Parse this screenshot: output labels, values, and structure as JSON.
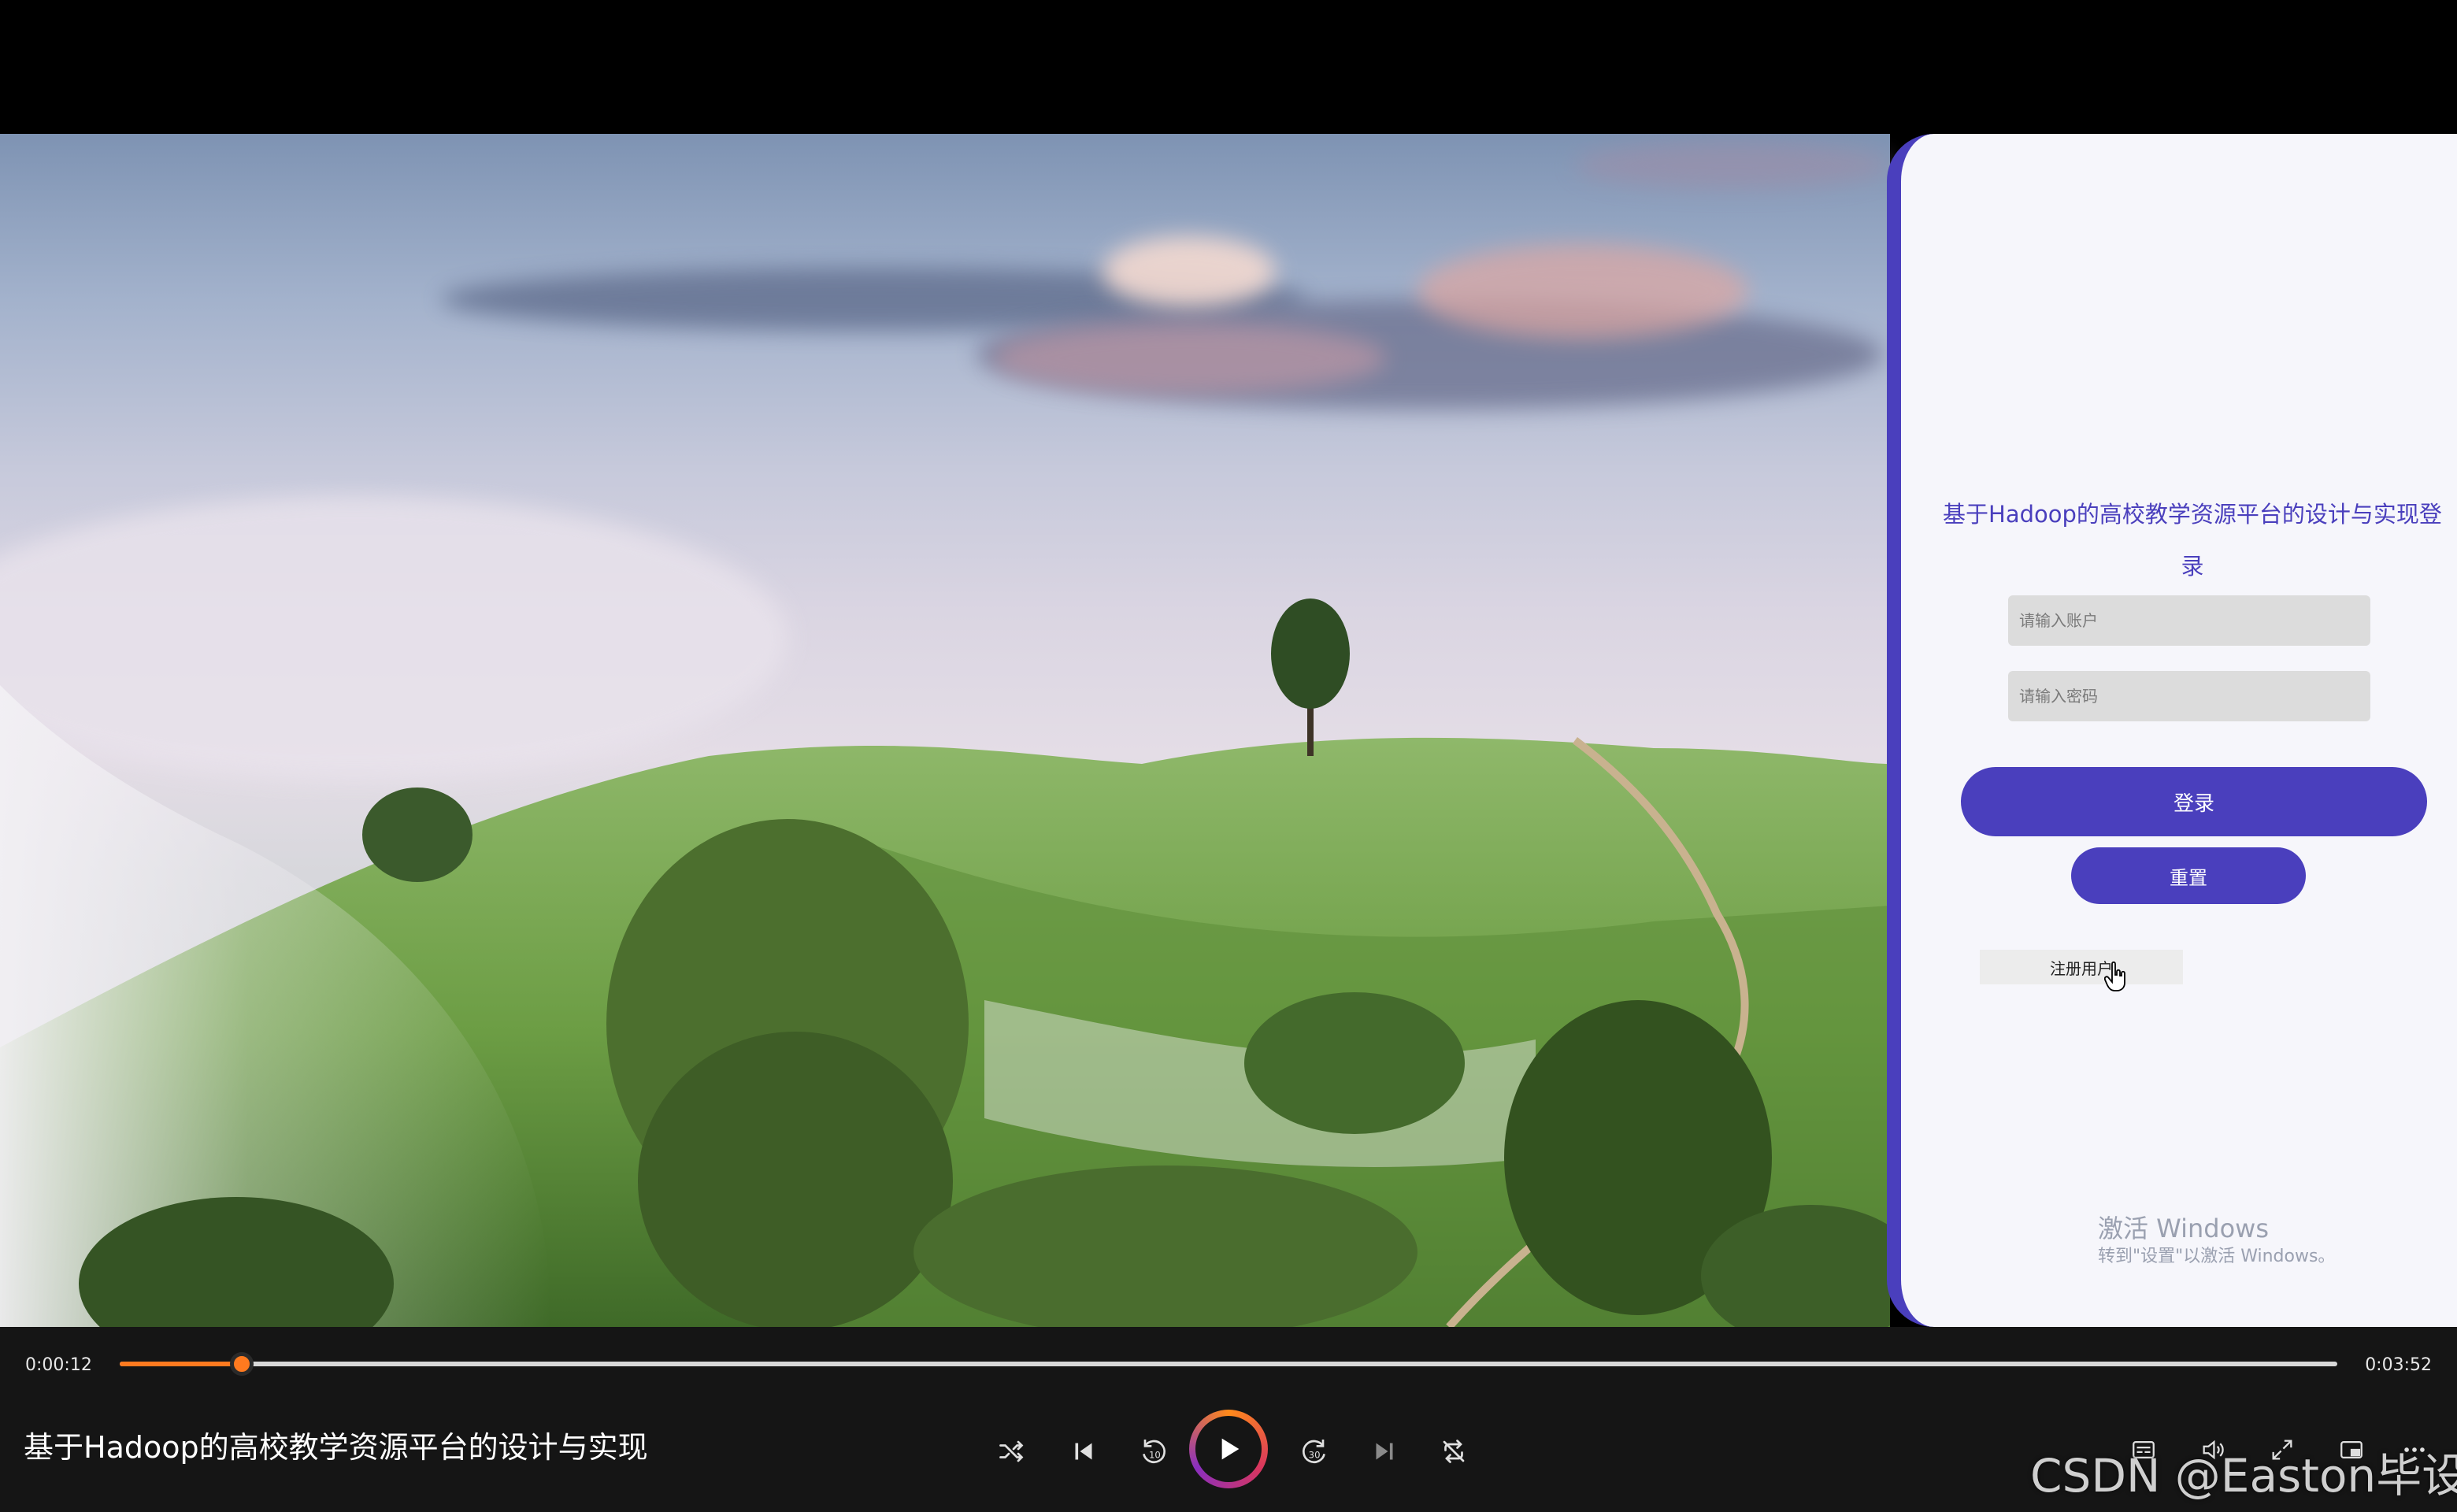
{
  "login": {
    "title": "基于Hadoop的高校教学资源平台的设计与实现登录",
    "account_placeholder": "请输入账户",
    "password_placeholder": "请输入密码",
    "login_label": "登录",
    "reset_label": "重置",
    "register_label": "注册用户",
    "accent_color": "#4a3fbd"
  },
  "windows_activation": {
    "title": "激活 Windows",
    "subtitle": "转到\"设置\"以激活 Windows。"
  },
  "player": {
    "elapsed": "0:00:12",
    "duration": "0:03:52",
    "progress_fraction": 0.055,
    "video_title": "基于Hadoop的高校教学资源平台的设计与实现",
    "accent_color": "#ff7a1f",
    "controls": [
      "shuffle-icon",
      "previous-icon",
      "rewind-10-icon",
      "play-icon",
      "forward-30-icon",
      "next-icon",
      "repeat-icon"
    ],
    "right_controls": [
      "subtitles-icon",
      "volume-icon",
      "fullscreen-icon",
      "mini-player-icon",
      "more-icon"
    ]
  },
  "watermark": "CSDN @Easton毕设"
}
